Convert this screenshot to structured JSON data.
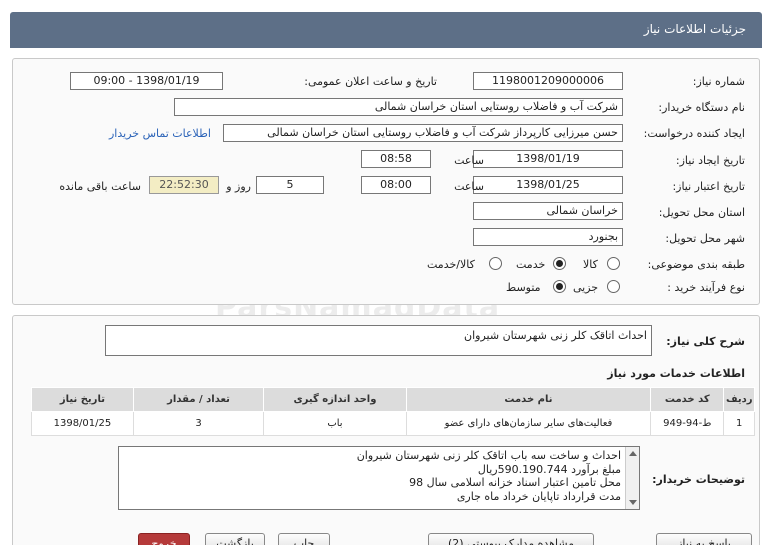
{
  "title": "جزئیات اطلاعات نیاز",
  "fields": {
    "need_number_label": "شماره نیاز:",
    "need_number": "1198001209000006",
    "announce_label": "تاریخ و ساعت اعلان عمومی:",
    "announce_value": "1398/01/19 - 09:00",
    "buyer_org_label": "نام دستگاه خریدار:",
    "buyer_org": "شرکت آب و فاضلاب روستایی استان خراسان شمالی",
    "creator_label": "ایجاد کننده درخواست:",
    "creator": "حسن  میرزایی کارپرداز شرکت آب و فاضلاب روستایی استان خراسان شمالی",
    "contact_link": "اطلاعات تماس خریدار",
    "created_date_label": "تاریخ ایجاد نیاز:",
    "created_date": "1398/01/19",
    "time_label": "ساعت",
    "created_time": "08:58",
    "validity_label": "تاریخ اعتبار نیاز:",
    "validity_date": "1398/01/25",
    "validity_time": "08:00",
    "days_label": "روز و",
    "days": "5",
    "remaining_time": "22:52:30",
    "remaining_label": "ساعت باقی مانده",
    "province_label": "استان محل تحویل:",
    "province": "خراسان شمالی",
    "city_label": "شهر محل تحویل:",
    "city": "بجنورد",
    "category_label": "طبقه بندی موضوعی:",
    "category_options": [
      "کالا",
      "خدمت",
      "کالا/خدمت"
    ],
    "process_label": "نوع فرآیند خرید :",
    "process_options": [
      "جزیی",
      "متوسط"
    ]
  },
  "summary": {
    "label": "شرح کلی نیاز:",
    "value": "احداث اتاقک کلر زنی شهرستان شیروان"
  },
  "services": {
    "heading": "اطلاعات خدمات مورد نیاز",
    "columns": [
      "ردیف",
      "کد خدمت",
      "نام خدمت",
      "واحد اندازه گیری",
      "تعداد / مقدار",
      "تاریخ نیاز"
    ],
    "rows": [
      [
        "1",
        "ط-94-949",
        "فعالیت‌های سایر سازمان‌های دارای عضو",
        "باب",
        "3",
        "1398/01/25"
      ]
    ]
  },
  "buyer_desc": {
    "label": "توضیحات خریدار:",
    "lines": [
      "احداث و ساخت سه باب اتاقک کلر زنی شهرستان شیروان",
      "مبلغ برآورد 590.190.744ریال",
      "محل تامین اعتبار اسناد خزانه اسلامی سال 98",
      "مدت قرارداد تاپایان خرداد ماه جاری"
    ]
  },
  "buttons": {
    "reply": "پاسخ به نیاز",
    "attachments": "مشاهده مدارک پیوستی (2)",
    "print": "چاپ",
    "back": "بازگشت",
    "exit": "خروج"
  },
  "watermark": "ParsNamadData"
}
